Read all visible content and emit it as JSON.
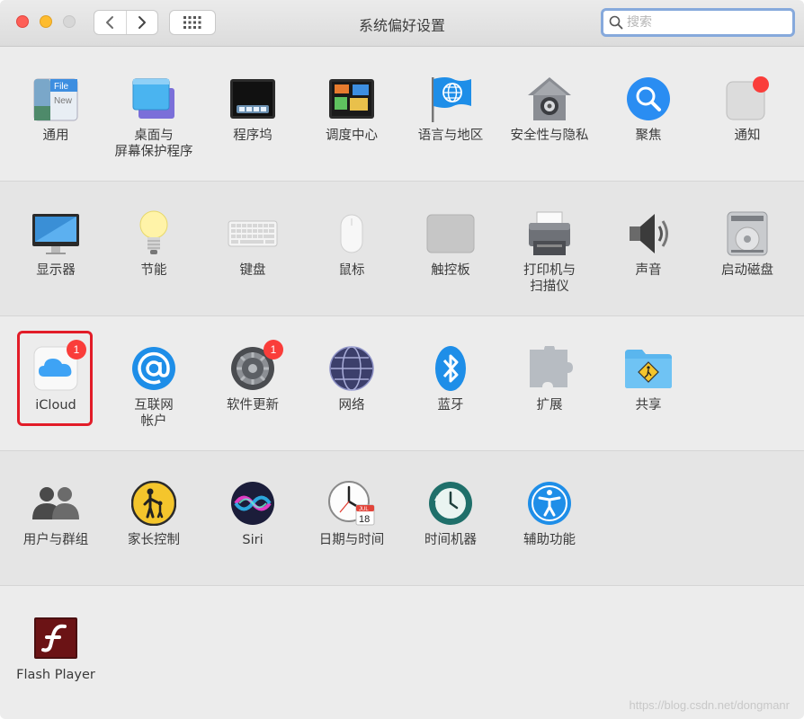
{
  "window": {
    "title": "系统偏好设置"
  },
  "toolbar": {
    "search_placeholder": "搜索"
  },
  "colors": {
    "accent": "#86a9dc",
    "highlight": "#e21c28",
    "badge": "#fa3d3a"
  },
  "rows": [
    [
      {
        "label": "通用",
        "icon": "general-icon"
      },
      {
        "label": "桌面与\n屏幕保护程序",
        "icon": "desktop-screensaver-icon"
      },
      {
        "label": "程序坞",
        "icon": "dock-icon"
      },
      {
        "label": "调度中心",
        "icon": "mission-control-icon"
      },
      {
        "label": "语言与地区",
        "icon": "language-region-icon"
      },
      {
        "label": "安全性与隐私",
        "icon": "security-privacy-icon"
      },
      {
        "label": "聚焦",
        "icon": "spotlight-icon"
      },
      {
        "label": "通知",
        "icon": "notifications-icon"
      }
    ],
    [
      {
        "label": "显示器",
        "icon": "displays-icon"
      },
      {
        "label": "节能",
        "icon": "energy-saver-icon"
      },
      {
        "label": "键盘",
        "icon": "keyboard-icon"
      },
      {
        "label": "鼠标",
        "icon": "mouse-icon"
      },
      {
        "label": "触控板",
        "icon": "trackpad-icon"
      },
      {
        "label": "打印机与\n扫描仪",
        "icon": "printer-scanner-icon"
      },
      {
        "label": "声音",
        "icon": "sound-icon"
      },
      {
        "label": "启动磁盘",
        "icon": "startup-disk-icon"
      }
    ],
    [
      {
        "label": "iCloud",
        "icon": "icloud-icon",
        "badge": "1"
      },
      {
        "label": "互联网\n帐户",
        "icon": "internet-accounts-icon"
      },
      {
        "label": "软件更新",
        "icon": "software-update-icon",
        "badge": "1"
      },
      {
        "label": "网络",
        "icon": "network-icon"
      },
      {
        "label": "蓝牙",
        "icon": "bluetooth-icon"
      },
      {
        "label": "扩展",
        "icon": "extensions-icon"
      },
      {
        "label": "共享",
        "icon": "sharing-icon"
      }
    ],
    [
      {
        "label": "用户与群组",
        "icon": "users-groups-icon"
      },
      {
        "label": "家长控制",
        "icon": "parental-controls-icon"
      },
      {
        "label": "Siri",
        "icon": "siri-icon"
      },
      {
        "label": "日期与时间",
        "icon": "date-time-icon"
      },
      {
        "label": "时间机器",
        "icon": "time-machine-icon"
      },
      {
        "label": "辅助功能",
        "icon": "accessibility-icon"
      }
    ],
    [
      {
        "label": "Flash Player",
        "icon": "flash-player-icon"
      }
    ]
  ],
  "icon_text": {
    "file": "File",
    "new": "New",
    "calendar_month": "JUL",
    "calendar_day": "18"
  },
  "watermark": "https://blog.csdn.net/dongmanr"
}
